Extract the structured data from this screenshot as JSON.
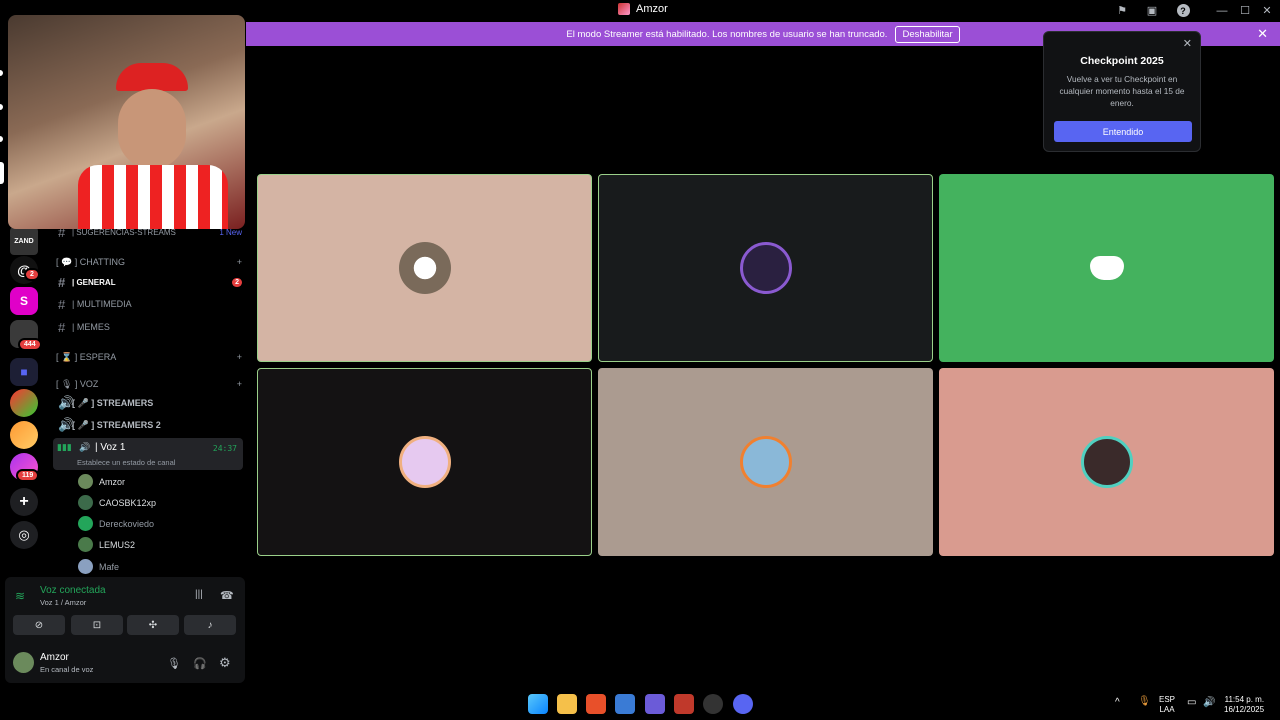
{
  "window": {
    "title": "Amzor"
  },
  "banner": {
    "text": "El modo Streamer está habilitado. Los nombres de usuario se han truncado.",
    "button": "Deshabilitar"
  },
  "rail": {
    "badges": {
      "first": "2",
      "group": "444",
      "last": "119"
    },
    "letter": "S"
  },
  "sidebar": {
    "top_channel": {
      "name": "| SUGERENCIAS-STREAMS",
      "badge": "1 New"
    },
    "cat_chatting": "[ 💬 ] CHATTING",
    "channels": [
      {
        "name": "| GENERAL",
        "badge": "2"
      },
      {
        "name": "| MULTIMEDIA"
      },
      {
        "name": "| MEMES"
      }
    ],
    "cat_espera": "[ ⌛ ] ESPERA",
    "cat_voz": "[ 🎙 ] VOZ",
    "voice_channels": [
      "[ 🎤 ] STREAMERS",
      "[ 🎤 ] STREAMERS 2"
    ],
    "active_voice": {
      "name": "| Voz 1",
      "timer": "24:37",
      "status": "Establece un estado de canal"
    },
    "members": [
      "Amzor",
      "CAOSBK12xp",
      "Dereckoviedo",
      "LEMUS2",
      "Mafe"
    ]
  },
  "voice_panel": {
    "status": "Voz conectada",
    "location": "Voz 1 / Amzor"
  },
  "user": {
    "name": "Amzor",
    "status": "En canal de voz"
  },
  "popup": {
    "title": "Checkpoint 2025",
    "desc": "Vuelve a ver tu Checkpoint en cualquier momento hasta el 15 de enero.",
    "button": "Entendido"
  },
  "tray": {
    "lang_top": "ESP",
    "lang_bottom": "LAA",
    "time": "11:54 p. m.",
    "date": "16/12/2025"
  },
  "colors": {
    "accent": "#5865f2",
    "banner": "#9b4fd6",
    "connected": "#23a55a",
    "tile1": "#d4b4a4",
    "tile2": "#181b1c",
    "tile3": "#44b25e",
    "tile4": "#141213",
    "tile5": "#ab9b90",
    "tile6": "#d99b8f"
  }
}
